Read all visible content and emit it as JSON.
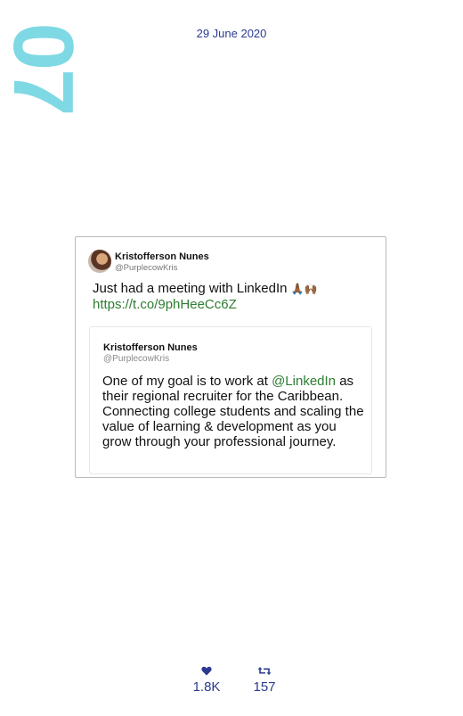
{
  "big_number": "07",
  "date": "29 June 2020",
  "tweet": {
    "author_name": "Kristofferson Nunes",
    "author_handle": "@PurplecowKris",
    "text": "Just had a meeting with LinkedIn",
    "emoji": "🙏🏾🙌🏾",
    "link": "https://t.co/9phHeeCc6Z",
    "quoted": {
      "author_name": "Kristofferson Nunes",
      "author_handle": "@PurplecowKris",
      "text_before": "One of my goal is to work at ",
      "mention": "@LinkedIn",
      "text_after": " as their regional recruiter for the Caribbean. Connecting college students and scaling the value of learning & development as you grow through your professional journey."
    }
  },
  "stats": {
    "likes_icon": "heart-icon",
    "likes": "1.8K",
    "retweets_icon": "retweet-icon",
    "retweets": "157"
  },
  "colors": {
    "accent": "#7fd9e4",
    "date_and_stats": "#2b3a8f",
    "link": "#2e7d32"
  }
}
